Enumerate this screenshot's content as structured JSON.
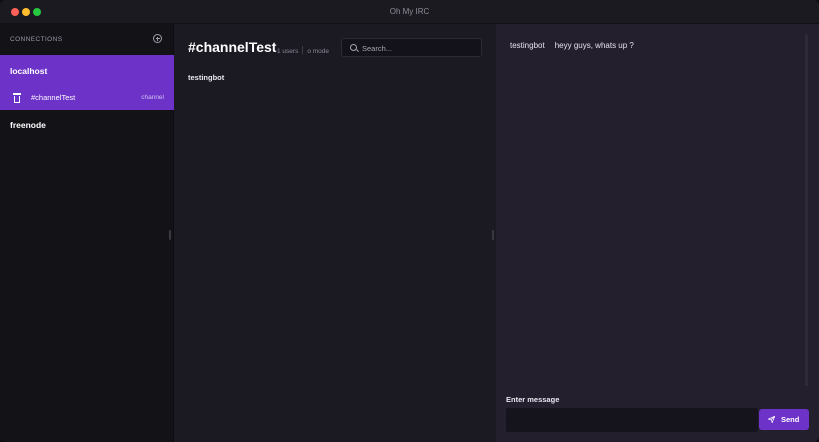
{
  "app": {
    "title": "Oh My IRC"
  },
  "colors": {
    "accent": "#6d32c8",
    "sidebar_bg": "#131217",
    "middle_bg": "#1b1922",
    "chat_bg": "#231f2c"
  },
  "sidebar": {
    "header": "CONNECTIONS",
    "add_icon": "plus-circle-icon",
    "servers": [
      {
        "name": "localhost",
        "active": true,
        "channels": [
          {
            "name": "#channelTest",
            "type": "channel",
            "icon": "trash-icon"
          }
        ]
      },
      {
        "name": "freenode",
        "active": false,
        "channels": []
      }
    ]
  },
  "channel": {
    "title": "#channelTest",
    "users_count": "1 users",
    "mode": "o mode",
    "search_placeholder": "Search...",
    "users": [
      "testingbot"
    ]
  },
  "chat": {
    "messages": [
      {
        "user": "testingbot",
        "text": "heyy guys, whats up ?"
      }
    ],
    "enter_label": "Enter message",
    "input_value": "",
    "send_label": "Send",
    "send_icon": "paper-plane-icon"
  }
}
